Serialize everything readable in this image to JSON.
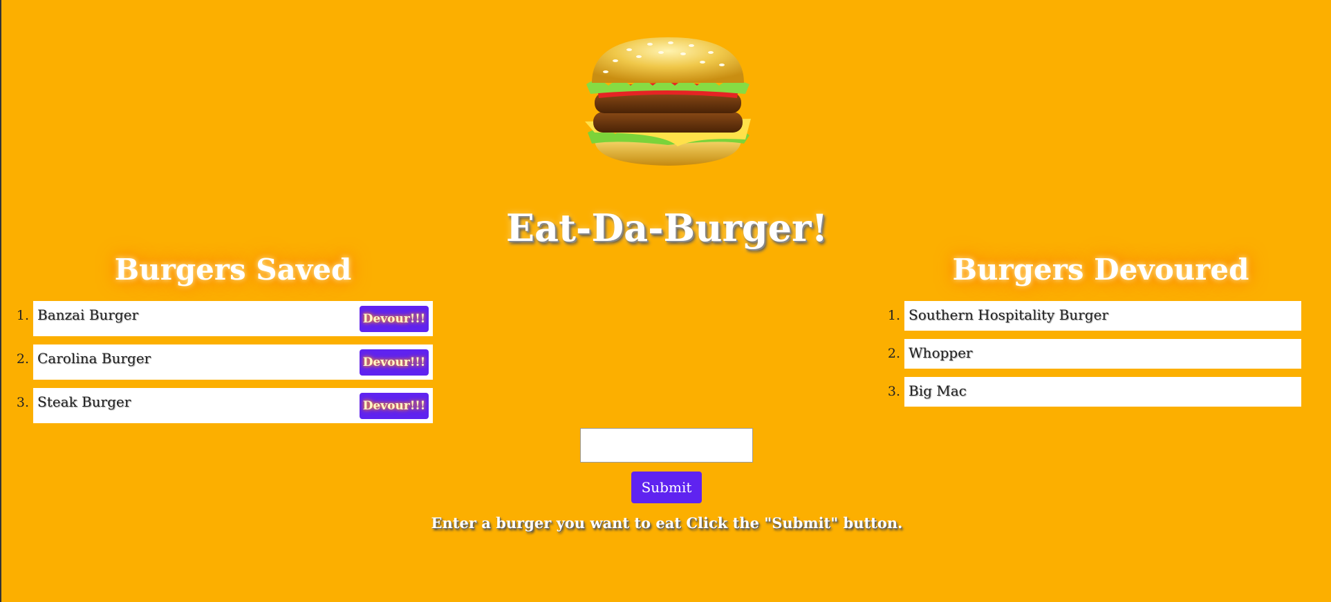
{
  "header": {
    "logo_icon": "hamburger-icon",
    "title": "Eat-Da-Burger!"
  },
  "saved": {
    "title": "Burgers Saved",
    "items": [
      {
        "number": "1.",
        "name": "Banzai Burger",
        "button_label": "Devour!!!"
      },
      {
        "number": "2.",
        "name": "Carolina Burger",
        "button_label": "Devour!!!"
      },
      {
        "number": "3.",
        "name": "Steak Burger",
        "button_label": "Devour!!!"
      }
    ]
  },
  "devoured": {
    "title": "Burgers Devoured",
    "items": [
      {
        "number": "1.",
        "name": "Southern Hospitality Burger"
      },
      {
        "number": "2.",
        "name": "Whopper"
      },
      {
        "number": "3.",
        "name": "Big Mac"
      }
    ]
  },
  "form": {
    "input_value": "",
    "input_placeholder": "",
    "submit_label": "Submit",
    "instructions": "Enter a burger you want to eat Click the \"Submit\" button."
  },
  "colors": {
    "background": "#fcaf00",
    "button": "#5f23f0",
    "glow": "#ff7a00"
  }
}
